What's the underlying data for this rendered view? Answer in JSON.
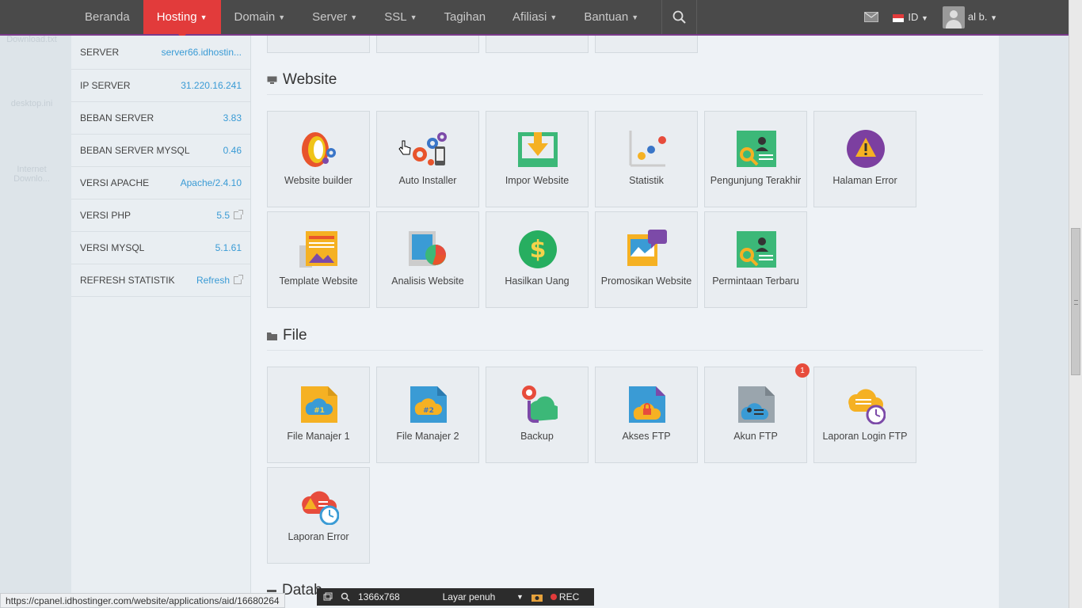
{
  "nav": {
    "items": [
      {
        "label": "Beranda",
        "caret": false
      },
      {
        "label": "Hosting",
        "caret": true,
        "active": true
      },
      {
        "label": "Domain",
        "caret": true
      },
      {
        "label": "Server",
        "caret": true
      },
      {
        "label": "SSL",
        "caret": true
      },
      {
        "label": "Tagihan",
        "caret": false
      },
      {
        "label": "Afiliasi",
        "caret": true
      },
      {
        "label": "Bantuan",
        "caret": true
      }
    ],
    "language": "ID",
    "user": "al b.",
    "search_icon": "search-icon"
  },
  "sidebar": {
    "stats": [
      {
        "label": "SERVER",
        "value": "server66.idhostin..."
      },
      {
        "label": "IP SERVER",
        "value": "31.220.16.241"
      },
      {
        "label": "BEBAN SERVER",
        "value": "3.83"
      },
      {
        "label": "BEBAN SERVER MYSQL",
        "value": "0.46"
      },
      {
        "label": "VERSI APACHE",
        "value": "Apache/2.4.10"
      },
      {
        "label": "VERSI PHP",
        "value": "5.5"
      },
      {
        "label": "VERSI MYSQL",
        "value": "5.1.61"
      },
      {
        "label": "REFRESH STATISTIK",
        "value": "Refresh"
      }
    ]
  },
  "sections": {
    "website": {
      "title": "Website",
      "tiles": [
        {
          "label": "Website builder",
          "icon": "website-builder-icon"
        },
        {
          "label": "Auto Installer",
          "icon": "auto-installer-icon"
        },
        {
          "label": "Impor Website",
          "icon": "import-website-icon"
        },
        {
          "label": "Statistik",
          "icon": "statistics-icon"
        },
        {
          "label": "Pengunjung Terakhir",
          "icon": "latest-visitors-icon"
        },
        {
          "label": "Halaman Error",
          "icon": "error-page-icon"
        },
        {
          "label": "Template Website",
          "icon": "website-template-icon"
        },
        {
          "label": "Analisis Website",
          "icon": "website-analysis-icon"
        },
        {
          "label": "Hasilkan Uang",
          "icon": "make-money-icon"
        },
        {
          "label": "Promosikan Website",
          "icon": "promote-website-icon"
        },
        {
          "label": "Permintaan Terbaru",
          "icon": "latest-requests-icon"
        }
      ]
    },
    "file": {
      "title": "File",
      "tiles": [
        {
          "label": "File Manajer 1",
          "icon": "file-manager-1-icon"
        },
        {
          "label": "File Manajer 2",
          "icon": "file-manager-2-icon"
        },
        {
          "label": "Backup",
          "icon": "backup-icon"
        },
        {
          "label": "Akses FTP",
          "icon": "ftp-access-icon"
        },
        {
          "label": "Akun FTP",
          "icon": "ftp-account-icon",
          "badge": "1"
        },
        {
          "label": "Laporan Login FTP",
          "icon": "ftp-login-report-icon"
        },
        {
          "label": "Laporan Error",
          "icon": "error-report-icon"
        }
      ]
    },
    "database": {
      "title": "Datab"
    }
  },
  "statusbar": {
    "url": "https://cpanel.idhostinger.com/website/applications/aid/16680264"
  },
  "recorder": {
    "resolution": "1366x768",
    "mode": "Layar penuh",
    "rec": "REC"
  },
  "desktop": {
    "labels": [
      "Download.txt",
      "desktop.ini",
      "Internet Downlo..."
    ]
  }
}
